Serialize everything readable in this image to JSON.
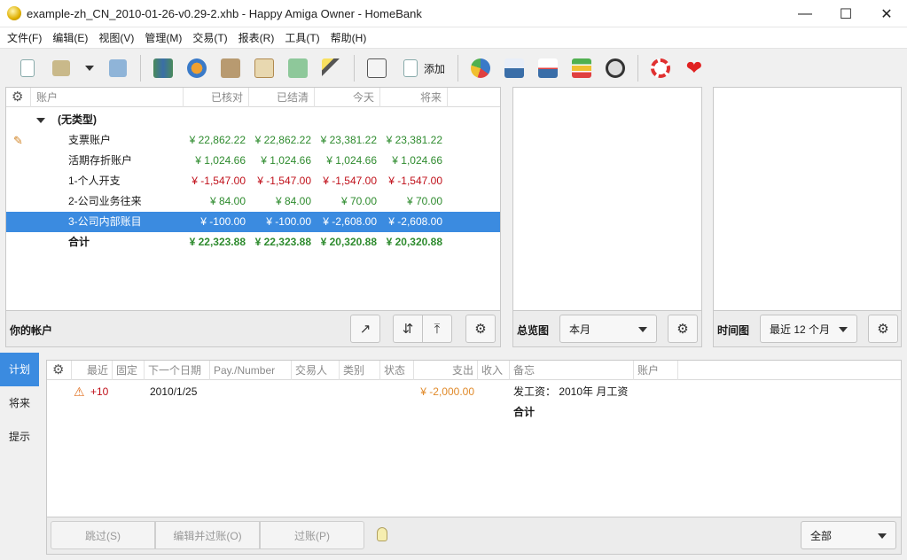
{
  "window": {
    "title": "example-zh_CN_2010-01-26-v0.29-2.xhb - Happy Amiga Owner - HomeBank"
  },
  "menu": [
    "文件(F)",
    "编辑(E)",
    "视图(V)",
    "管理(M)",
    "交易(T)",
    "报表(R)",
    "工具(T)",
    "帮助(H)"
  ],
  "toolbar": {
    "add_label": "添加"
  },
  "accounts": {
    "columns": [
      "账户",
      "已核对",
      "已结清",
      "今天",
      "将来"
    ],
    "group": "(无类型)",
    "rows": [
      {
        "name": "支票账户",
        "reconciled": "¥ 22,862.22",
        "cleared": "¥ 22,862.22",
        "today": "¥ 23,381.22",
        "future": "¥ 23,381.22",
        "sign": "pos"
      },
      {
        "name": "活期存折账户",
        "reconciled": "¥ 1,024.66",
        "cleared": "¥ 1,024.66",
        "today": "¥ 1,024.66",
        "future": "¥ 1,024.66",
        "sign": "pos"
      },
      {
        "name": "1-个人开支",
        "reconciled": "¥ -1,547.00",
        "cleared": "¥ -1,547.00",
        "today": "¥ -1,547.00",
        "future": "¥ -1,547.00",
        "sign": "neg"
      },
      {
        "name": "2-公司业务往来",
        "reconciled": "¥ 84.00",
        "cleared": "¥ 84.00",
        "today": "¥ 70.00",
        "future": "¥ 70.00",
        "sign": "pos"
      },
      {
        "name": "3-公司内部账目",
        "reconciled": "¥ -100.00",
        "cleared": "¥ -100.00",
        "today": "¥ -2,608.00",
        "future": "¥ -2,608.00",
        "sign": "sel"
      }
    ],
    "total": {
      "name": "合计",
      "reconciled": "¥ 22,323.88",
      "cleared": "¥ 22,323.88",
      "today": "¥ 20,320.88",
      "future": "¥ 20,320.88"
    },
    "footer_label": "你的帐户"
  },
  "overview": {
    "label": "总览图",
    "period": "本月"
  },
  "timechart": {
    "label": "时间图",
    "period": "最近 12 个月"
  },
  "side_tabs": [
    "计划",
    "将来",
    "提示"
  ],
  "schedule": {
    "columns": [
      "最近",
      "固定",
      "下一个日期",
      "Pay./Number",
      "交易人",
      "类别",
      "状态",
      "支出",
      "收入",
      "备忘",
      "账户"
    ],
    "row": {
      "late": "+10",
      "date": "2010/1/25",
      "expense": "¥ -2,000.00",
      "memo": "发工资： 2010年 月工资"
    },
    "total_label": "合计",
    "buttons": {
      "skip": "跳过(S)",
      "edit_post": "编辑并过账(O)",
      "post": "过账(P)"
    },
    "filter": "全部"
  },
  "colors": {
    "selection": "#3b8be0",
    "positive": "#2e8b2e",
    "negative": "#c0101a",
    "expense": "#e08a2a"
  }
}
